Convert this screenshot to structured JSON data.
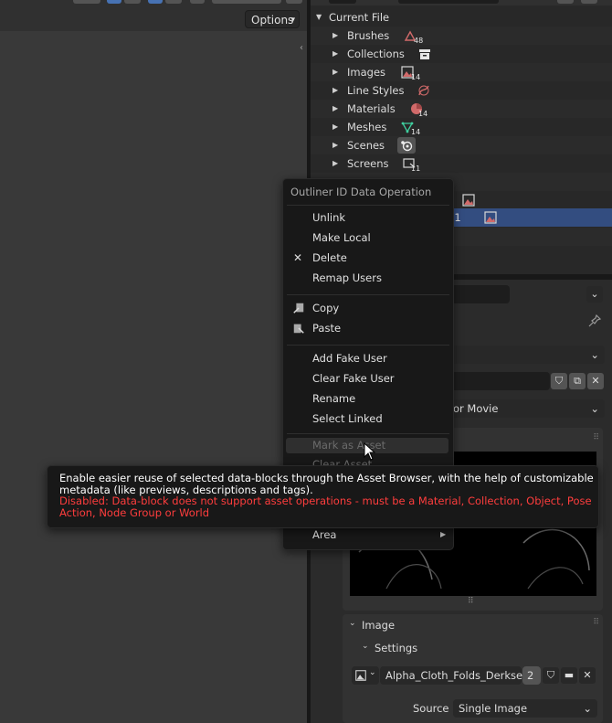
{
  "viewport": {
    "options_label": "Options"
  },
  "outliner": {
    "root_label": "Current File",
    "items": [
      {
        "label": "Brushes",
        "count": "48",
        "icon": "brush-icon"
      },
      {
        "label": "Collections",
        "count": "",
        "icon": "collection-box-icon"
      },
      {
        "label": "Images",
        "count": "14",
        "icon": "image-icon"
      },
      {
        "label": "Line Styles",
        "count": "",
        "icon": "linestyle-icon"
      },
      {
        "label": "Materials",
        "count": "14",
        "icon": "material-icon"
      },
      {
        "label": "Meshes",
        "count": "14",
        "icon": "mesh-icon"
      },
      {
        "label": "Scenes",
        "count": "",
        "icon": "scene-icon"
      },
      {
        "label": "Screens",
        "count": "11",
        "icon": "screen-icon"
      }
    ],
    "partial_row_text": "01"
  },
  "menu": {
    "title": "Outliner ID Data Operation",
    "items": {
      "unlink": "Unlink",
      "make_local": "Make Local",
      "delete": "Delete",
      "remap_users": "Remap Users",
      "copy": "Copy",
      "paste": "Paste",
      "add_fake_user": "Add Fake User",
      "clear_fake_user": "Clear Fake User",
      "rename": "Rename",
      "select_linked": "Select Linked",
      "mark_as_asset": "Mark as Asset",
      "clear_asset": "Clear Asset",
      "area": "Area"
    }
  },
  "tooltip": {
    "description": "Enable easier reuse of selected data-blocks through the Asset Browser, with the help of customizable metadata (like previews, descriptions and tags).",
    "disabled": "Disabled: Data-block does not support asset operations - must be a Material, Collection, Object, Pose Action, Node Group or World"
  },
  "properties": {
    "source_type_partial": "or Movie",
    "panel_image": "Image",
    "panel_settings": "Settings",
    "image_name": "Alpha_Cloth_Folds_Derksen...",
    "image_users": "2",
    "source_label": "Source",
    "source_value": "Single Image"
  },
  "colors": {
    "selected_row": "#334d80",
    "disabled_text": "#ff3d3d",
    "accent_blue": "#4772b3"
  }
}
